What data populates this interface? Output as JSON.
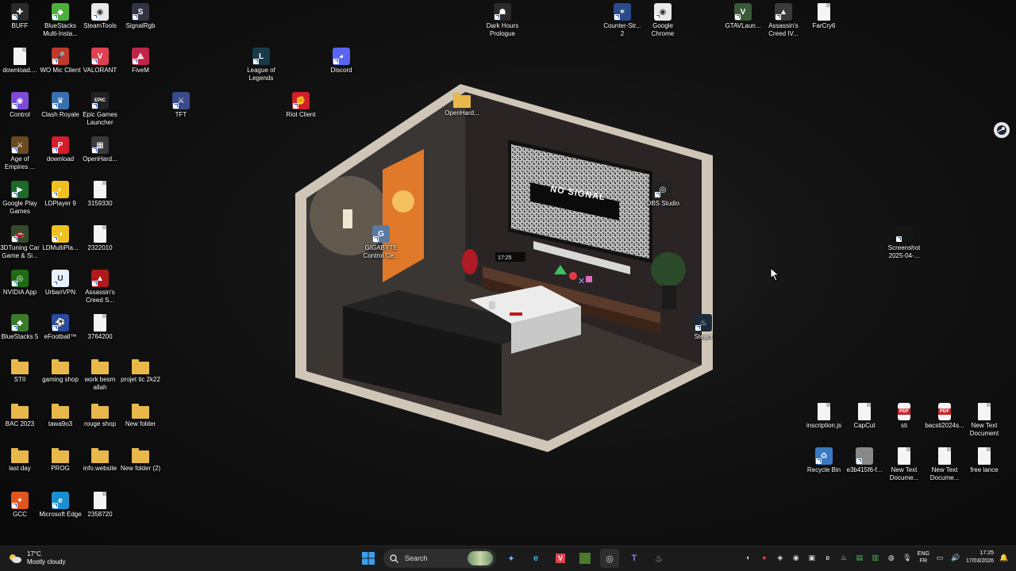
{
  "desktop": {
    "col1": [
      {
        "label": "BUFF",
        "icon": "buff-icon",
        "color": "#2a2a2a",
        "glyph": "✚"
      },
      {
        "label": "download....",
        "icon": "file-icon",
        "kind": "file"
      },
      {
        "label": "Control",
        "icon": "control-icon",
        "color": "#7b4ad6",
        "glyph": "◉"
      },
      {
        "label": "Age of Empires ...",
        "icon": "age-of-empires-icon",
        "color": "#6b4a22",
        "glyph": "⚔"
      },
      {
        "label": "Google Play Games",
        "icon": "google-play-games-icon",
        "color": "#1b6b2a",
        "glyph": "▶"
      },
      {
        "label": "3DTuning Car Game & Si...",
        "icon": "3dtuning-icon",
        "color": "#354a2a",
        "glyph": "🚗"
      },
      {
        "label": "NVIDIA App",
        "icon": "nvidia-icon",
        "color": "#1e6b12",
        "glyph": "◎"
      },
      {
        "label": "BlueStacks 5",
        "icon": "bluestacks-icon",
        "color": "#3a7a2a",
        "glyph": "◆"
      },
      {
        "label": "STII",
        "icon": "folder-icon",
        "kind": "folder"
      },
      {
        "label": "BAC 2023",
        "icon": "folder-icon",
        "kind": "folder"
      },
      {
        "label": "last day",
        "icon": "folder-icon",
        "kind": "folder"
      },
      {
        "label": "GCC",
        "icon": "gcc-icon",
        "color": "#e0551c",
        "glyph": "✦"
      }
    ],
    "col2": [
      {
        "label": "BlueStacks Multi-Insta...",
        "icon": "bluestacks-multi-icon",
        "color": "#4caf3a",
        "glyph": "◆"
      },
      {
        "label": "WO Mic Client",
        "icon": "microphone-icon",
        "color": "#c0392b",
        "glyph": "🎤"
      },
      {
        "label": "Clash Royale",
        "icon": "clash-royale-icon",
        "color": "#3a6fb0",
        "glyph": "♛"
      },
      {
        "label": "download",
        "icon": "pinterest-icon",
        "color": "#d41c2c",
        "glyph": "P"
      },
      {
        "label": "LDPlayer 9",
        "icon": "ldplayer-icon",
        "color": "#f0c020",
        "glyph": "◐"
      },
      {
        "label": "LDMultiPla...",
        "icon": "ldmultiplayer-icon",
        "color": "#f0c020",
        "glyph": "◑"
      },
      {
        "label": "UrbanVPN",
        "icon": "urbanvpn-icon",
        "color": "#e8f0ff",
        "glyph": "U"
      },
      {
        "label": "eFootball™",
        "icon": "efootball-icon",
        "color": "#2a4aa0",
        "glyph": "⚽"
      },
      {
        "label": "gaming shop",
        "icon": "folder-icon",
        "kind": "folder"
      },
      {
        "label": "tawa9o3",
        "icon": "folder-icon",
        "kind": "folder"
      },
      {
        "label": "PROG",
        "icon": "folder-icon",
        "kind": "folder"
      },
      {
        "label": "Microsoft Edge",
        "icon": "edge-icon",
        "color": "#1a8fd0",
        "glyph": "e"
      }
    ],
    "col3": [
      {
        "label": "SteamTools",
        "icon": "steamtools-icon",
        "color": "#e8e8e8",
        "glyph": "◉"
      },
      {
        "label": "VALORANT",
        "icon": "valorant-icon",
        "color": "#e04050",
        "glyph": "V"
      },
      {
        "label": "Epic Games Launcher",
        "icon": "epic-games-icon",
        "color": "#222222",
        "glyph": "EPIC"
      },
      {
        "label": "OpenHard...",
        "icon": "openhardware-icon",
        "color": "#3a3a3a",
        "glyph": "▦"
      },
      {
        "label": "3159330",
        "icon": "file-icon",
        "kind": "file"
      },
      {
        "label": "2322010",
        "icon": "file-icon",
        "kind": "file"
      },
      {
        "label": "Assassin's Creed S...",
        "icon": "assassins-creed-icon",
        "color": "#b01a1a",
        "glyph": "▲"
      },
      {
        "label": "3764200",
        "icon": "file-icon",
        "kind": "file"
      },
      {
        "label": "work besm allah",
        "icon": "folder-icon",
        "kind": "folder"
      },
      {
        "label": "rouge shop",
        "icon": "folder-icon",
        "kind": "folder"
      },
      {
        "label": "info.website",
        "icon": "folder-icon",
        "kind": "folder"
      },
      {
        "label": "2358720",
        "icon": "file-icon",
        "kind": "file"
      }
    ],
    "col4": [
      {
        "label": "SignalRgb",
        "icon": "signalrgb-icon",
        "color": "#333344",
        "glyph": "S"
      },
      {
        "label": "FiveM",
        "icon": "fivem-icon",
        "color": "#c0244a",
        "glyph": "⟁"
      },
      {
        "label": "projet tic 2k22",
        "icon": "folder-icon",
        "kind": "folder"
      },
      {
        "label": "New folder",
        "icon": "folder-icon",
        "kind": "folder"
      },
      {
        "label": "New folder (2)",
        "icon": "folder-icon",
        "kind": "folder"
      }
    ],
    "misc": [
      {
        "label": "TFT",
        "icon": "tft-icon",
        "color": "#3a4a8a",
        "glyph": "⚔"
      },
      {
        "label": "League of Legends",
        "icon": "league-of-legends-icon",
        "color": "#1a3a4a",
        "glyph": "L"
      },
      {
        "label": "Riot Client",
        "icon": "riot-client-icon",
        "color": "#d0202a",
        "glyph": "✊"
      },
      {
        "label": "Discord",
        "icon": "discord-icon",
        "color": "#5865f2",
        "glyph": "◕"
      },
      {
        "label": "OpenHard...",
        "icon": "folder-icon",
        "kind": "folder"
      },
      {
        "label": "Dark Hours Prologue",
        "icon": "dark-hours-icon",
        "color": "#2a2a2a",
        "glyph": "☗"
      },
      {
        "label": "Counter-Str... 2",
        "icon": "counter-strike-icon",
        "color": "#2a4a8a",
        "glyph": "✶"
      },
      {
        "label": "Google Chrome",
        "icon": "chrome-icon",
        "color": "#e8e8e8",
        "glyph": "◉"
      },
      {
        "label": "GTAVLaun...",
        "icon": "gtav-icon",
        "color": "#3a5a3a",
        "glyph": "V"
      },
      {
        "label": "Assassin's Creed IV...",
        "icon": "assassins-creed-iv-icon",
        "color": "#3a3a3a",
        "glyph": "▲"
      },
      {
        "label": "FarCry6",
        "icon": "file-icon",
        "kind": "file"
      },
      {
        "label": "GIGABYTE Control Ce...",
        "icon": "gigabyte-icon",
        "color": "#5a7aa0",
        "glyph": "G"
      },
      {
        "label": "OBS Studio",
        "icon": "obs-icon",
        "color": "#222222",
        "glyph": "◎"
      },
      {
        "label": "Steam",
        "icon": "steam-icon",
        "color": "#1a2a3a",
        "glyph": "♨"
      },
      {
        "label": "Screenshot 2025-04-...",
        "icon": "screenshot-icon",
        "color": "#151515",
        "glyph": ""
      }
    ],
    "bottom_right": [
      {
        "label": "inscription.js",
        "icon": "file-icon",
        "kind": "file"
      },
      {
        "label": "CapCut",
        "icon": "file-icon",
        "kind": "file"
      },
      {
        "label": "sti",
        "icon": "pdf-icon",
        "kind": "pdf"
      },
      {
        "label": "bacsti2024s...",
        "icon": "pdf-icon",
        "kind": "pdf"
      },
      {
        "label": "New Text Document",
        "icon": "file-icon",
        "kind": "file"
      },
      {
        "label": "Recycle Bin",
        "icon": "recycle-bin-icon",
        "color": "#3a7ac0",
        "glyph": "♻"
      },
      {
        "label": "e3b415f6-f...",
        "icon": "image-file-icon",
        "color": "#888888",
        "glyph": ""
      },
      {
        "label": "New Text Docume...",
        "icon": "file-icon",
        "kind": "file"
      },
      {
        "label": "New Text Docume...",
        "icon": "file-icon",
        "kind": "file"
      },
      {
        "label": "free lance",
        "icon": "file-icon",
        "kind": "file"
      }
    ]
  },
  "wallpaper": {
    "tv_text": "NO SIGNAL",
    "clock_text": "17:25"
  },
  "taskbar": {
    "weather_temp": "17°C",
    "weather_desc": "Mostly cloudy",
    "search_placeholder": "Search",
    "language_top": "ENG",
    "language_bottom": "FR",
    "time": "17:25",
    "date": "17/03/2026"
  }
}
